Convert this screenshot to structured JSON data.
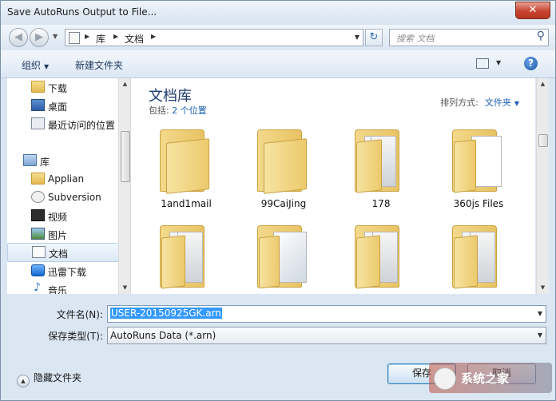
{
  "window": {
    "title": "Save AutoRuns Output to File...",
    "close_glyph": "✕"
  },
  "address": {
    "back_glyph": "◀",
    "forward_glyph": "▶",
    "crumbs": [
      "库",
      "文档"
    ],
    "search_placeholder": "搜索 文档"
  },
  "toolbar": {
    "organize": "组织",
    "new_folder": "新建文件夹",
    "help_glyph": "?"
  },
  "nav": {
    "items": [
      {
        "label": "下载",
        "icon": "folder-icon"
      },
      {
        "label": "桌面",
        "icon": "desktop-icon"
      },
      {
        "label": "最近访问的位置",
        "icon": "recent-places-icon"
      },
      {
        "label": "库",
        "icon": "library-icon"
      },
      {
        "label": "Applian",
        "icon": "folder-icon"
      },
      {
        "label": "Subversion",
        "icon": "subversion-icon"
      },
      {
        "label": "视频",
        "icon": "video-icon"
      },
      {
        "label": "图片",
        "icon": "pictures-icon"
      },
      {
        "label": "文档",
        "icon": "documents-icon",
        "selected": true
      },
      {
        "label": "迅雷下载",
        "icon": "thunder-icon"
      },
      {
        "label": "音乐",
        "icon": "music-icon"
      }
    ]
  },
  "library": {
    "title": "文档库",
    "includes_prefix": "包括:",
    "includes_link": "2 个位置",
    "arrange_label": "排列方式:",
    "arrange_value": "文件夹"
  },
  "folders": [
    {
      "label": "1and1mail"
    },
    {
      "label": "99CaiJing"
    },
    {
      "label": "178"
    },
    {
      "label": "360js Files"
    },
    {
      "label": ""
    },
    {
      "label": ""
    },
    {
      "label": ""
    },
    {
      "label": ""
    }
  ],
  "fields": {
    "filename_label": "文件名(N):",
    "filename_value": "USER-20150925GK.arn",
    "filetype_label": "保存类型(T):",
    "filetype_value": "AutoRuns Data (*.arn)"
  },
  "footer": {
    "hide_folders": "隐藏文件夹",
    "save_button": "保存",
    "cancel_button": "取消"
  },
  "watermark": {
    "text": "系统之家"
  }
}
